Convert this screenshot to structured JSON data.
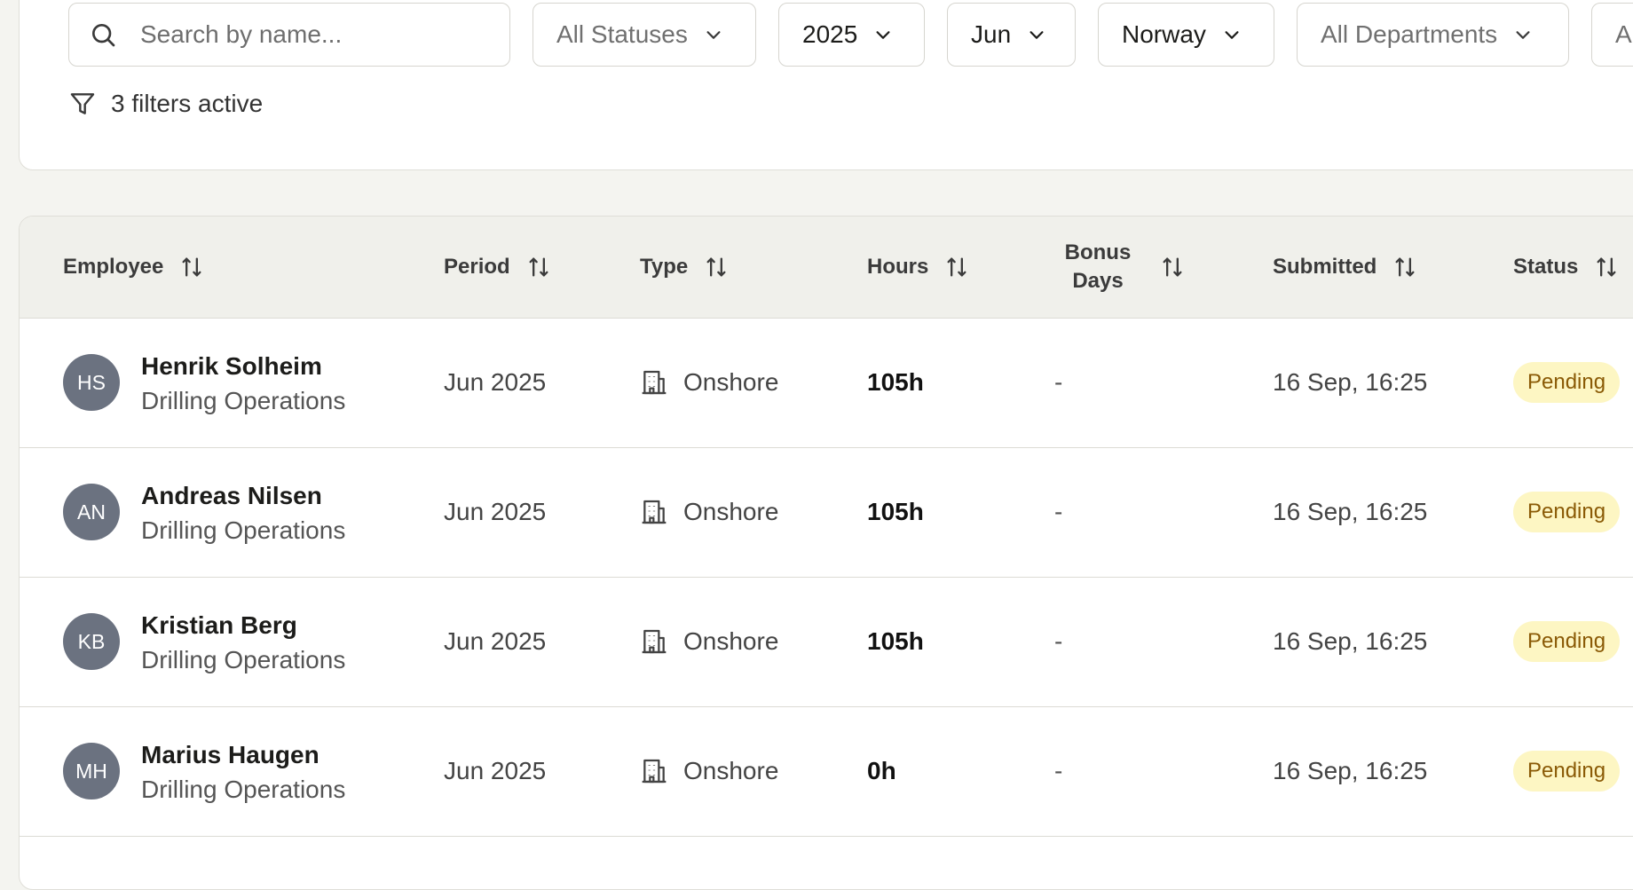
{
  "filters": {
    "search_placeholder": "Search by name...",
    "status": "All Statuses",
    "year": "2025",
    "month": "Jun",
    "country": "Norway",
    "department": "All Departments",
    "extra": "All A",
    "active_label": "3 filters active"
  },
  "table": {
    "columns": {
      "employee": "Employee",
      "period": "Period",
      "type": "Type",
      "hours": "Hours",
      "bonus_line1": "Bonus",
      "bonus_line2": "Days",
      "submitted": "Submitted",
      "status": "Status"
    },
    "rows": [
      {
        "initials": "HS",
        "name": "Henrik Solheim",
        "department": "Drilling Operations",
        "period": "Jun 2025",
        "type": "Onshore",
        "hours": "105h",
        "bonus_days": "-",
        "submitted": "16 Sep, 16:25",
        "status": "Pending"
      },
      {
        "initials": "AN",
        "name": "Andreas Nilsen",
        "department": "Drilling Operations",
        "period": "Jun 2025",
        "type": "Onshore",
        "hours": "105h",
        "bonus_days": "-",
        "submitted": "16 Sep, 16:25",
        "status": "Pending"
      },
      {
        "initials": "KB",
        "name": "Kristian Berg",
        "department": "Drilling Operations",
        "period": "Jun 2025",
        "type": "Onshore",
        "hours": "105h",
        "bonus_days": "-",
        "submitted": "16 Sep, 16:25",
        "status": "Pending"
      },
      {
        "initials": "MH",
        "name": "Marius Haugen",
        "department": "Drilling Operations",
        "period": "Jun 2025",
        "type": "Onshore",
        "hours": "0h",
        "bonus_days": "-",
        "submitted": "16 Sep, 16:25",
        "status": "Pending"
      }
    ]
  },
  "icons": {
    "search": "search-icon",
    "chevron": "chevron-down-icon",
    "filter": "filter-icon",
    "sort": "sort-arrows-icon",
    "building": "building-icon"
  },
  "colors": {
    "page_bg": "#f4f4f0",
    "header_bg": "#f0f0eb",
    "avatar_bg": "#6b7280",
    "pending_bg": "#fdf6c3",
    "pending_text": "#8a5a06"
  }
}
